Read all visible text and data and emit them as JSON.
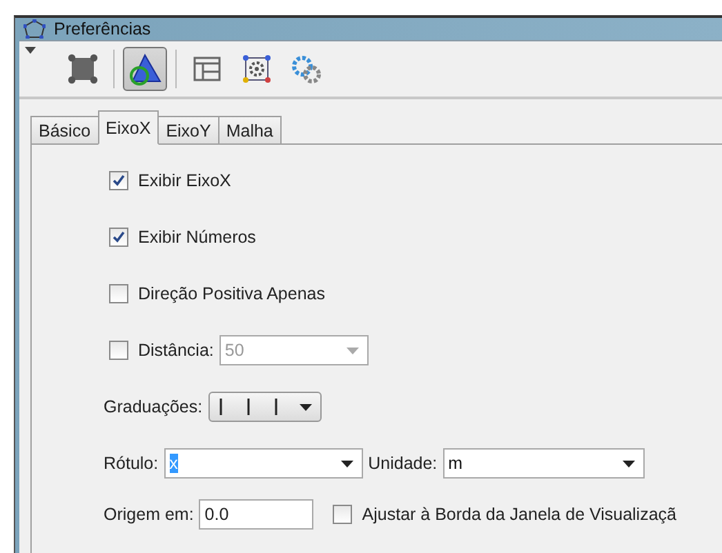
{
  "window": {
    "title": "Preferências"
  },
  "toolbar": [
    {
      "kind": "square",
      "selected": false
    },
    {
      "kind": "graphics",
      "selected": true
    },
    {
      "kind": "layout",
      "selected": false
    },
    {
      "kind": "gear_square",
      "selected": false
    },
    {
      "kind": "gears",
      "selected": false
    }
  ],
  "tabs": [
    {
      "label": "Básico",
      "selected": false
    },
    {
      "label": "EixoX",
      "selected": true
    },
    {
      "label": "EixoY",
      "selected": false
    },
    {
      "label": "Malha",
      "selected": false
    }
  ],
  "checkboxes": [
    {
      "label": "Exibir EixoX",
      "checked": true
    },
    {
      "label": "Exibir Números",
      "checked": true
    },
    {
      "label": "Direção Positiva Apenas",
      "checked": false
    }
  ],
  "distance": {
    "label": "Distância:",
    "checked": false,
    "value": "50",
    "disabled": true
  },
  "ticks": {
    "label": "Graduações:"
  },
  "axis_label": {
    "label": "Rótulo:",
    "value": "x",
    "text_selected": true
  },
  "unit": {
    "label": "Unidade:",
    "value": "m"
  },
  "origin": {
    "label": "Origem em:",
    "value": "0.0"
  },
  "fit_border": {
    "label": "Ajustar à Borda da Janela de Visualizaçã",
    "checked": false
  }
}
